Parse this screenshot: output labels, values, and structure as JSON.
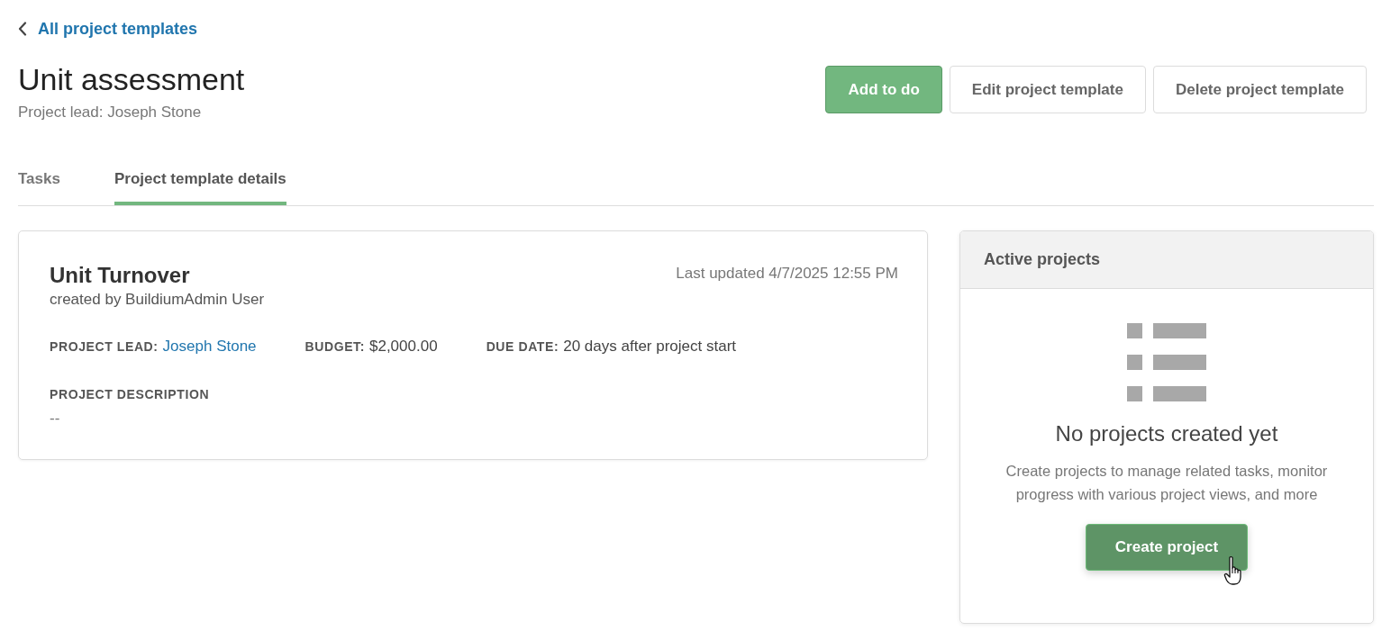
{
  "back_link": {
    "label": "All project templates"
  },
  "header": {
    "title": "Unit assessment",
    "subtitle": "Project lead: Joseph Stone"
  },
  "actions": [
    {
      "label": "Add to do",
      "kind": "primary"
    },
    {
      "label": "Edit project template",
      "kind": "secondary"
    },
    {
      "label": "Delete project template",
      "kind": "secondary"
    }
  ],
  "tabs": [
    {
      "label": "Tasks",
      "selected": false
    },
    {
      "label": "Project template details",
      "selected": true
    }
  ],
  "template_card": {
    "title": "Unit Turnover",
    "created_by": "created by BuildiumAdmin User",
    "last_updated": "Last updated 4/7/2025 12:55 PM",
    "fields": [
      {
        "label": "PROJECT LEAD:",
        "value": "Joseph Stone",
        "kind": "link"
      },
      {
        "label": "BUDGET:",
        "value": "$2,000.00",
        "kind": "text"
      },
      {
        "label": "DUE DATE:",
        "value": "20 days after project start",
        "kind": "text"
      }
    ],
    "description": {
      "label": "PROJECT DESCRIPTION",
      "value": "--"
    }
  },
  "active_projects": {
    "title": "Active projects",
    "empty_title": "No projects created yet",
    "empty_text": "Create projects to manage related tasks, monitor progress with various project views, and more",
    "button": {
      "label": "Create project",
      "hovered": true
    }
  }
}
